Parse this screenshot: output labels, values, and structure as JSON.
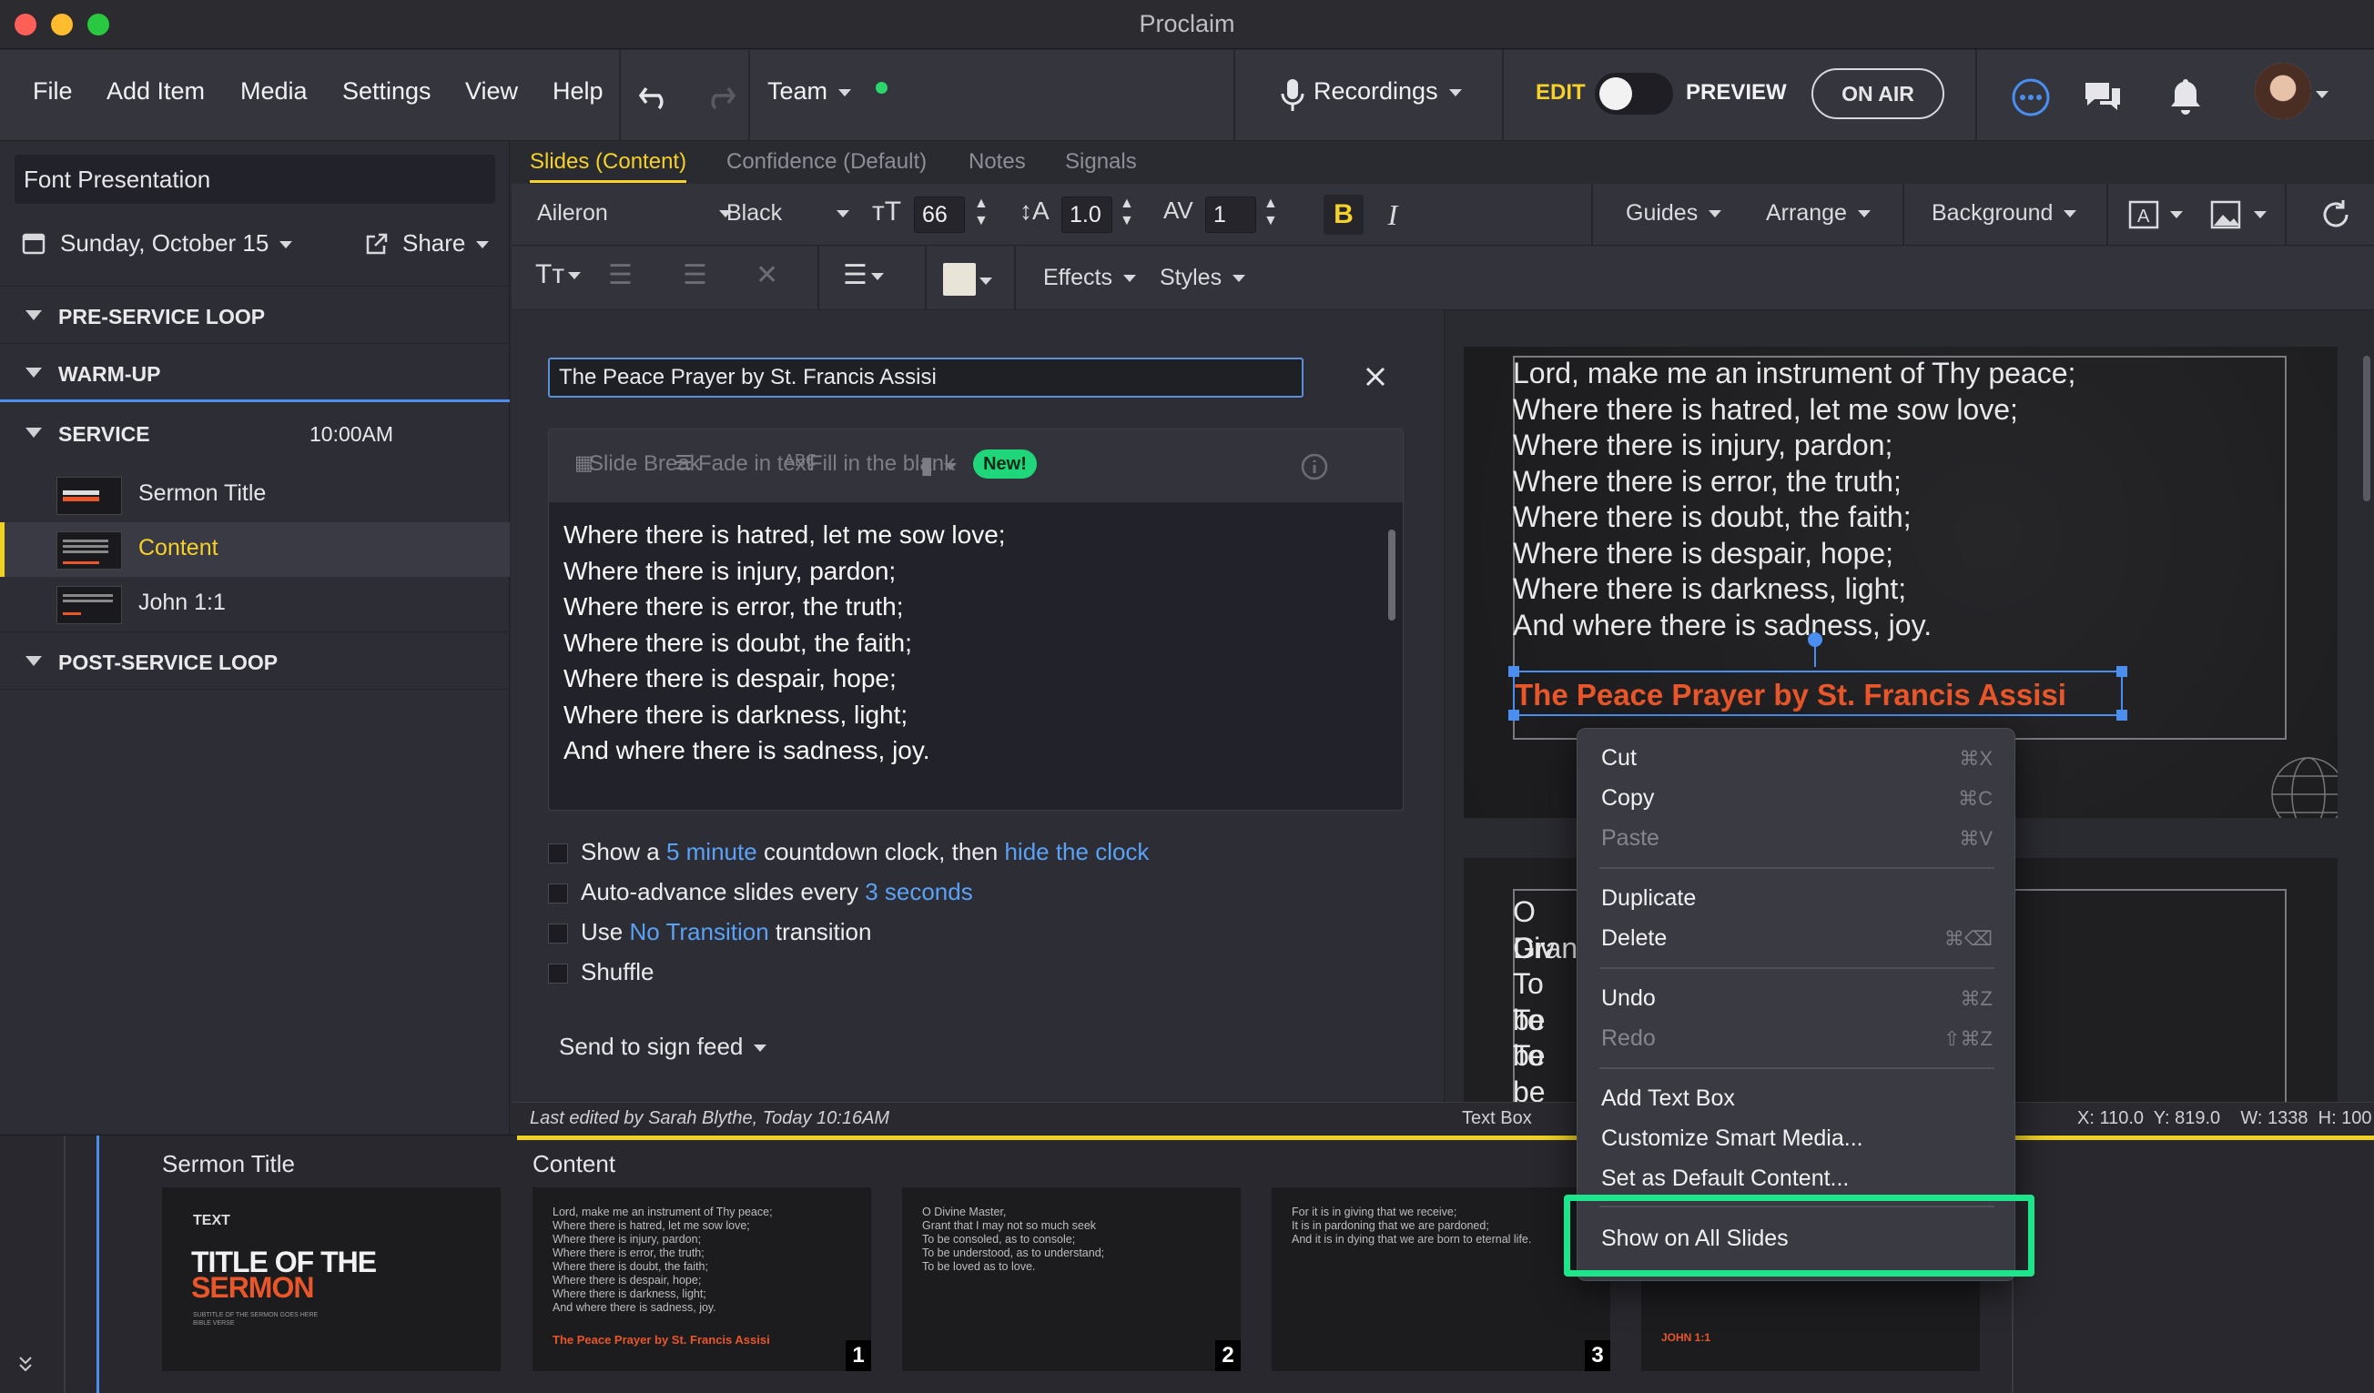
{
  "window": {
    "title": "Proclaim"
  },
  "menu": {
    "file": "File",
    "add_item": "Add Item",
    "media": "Media",
    "settings": "Settings",
    "view": "View",
    "help": "Help",
    "team": "Team",
    "recordings": "Recordings",
    "edit": "EDIT",
    "preview": "PREVIEW",
    "on_air": "ON AIR"
  },
  "sidebar": {
    "presentation_name": "Font Presentation",
    "date": "Sunday, October 15",
    "share": "Share",
    "sections": [
      {
        "label": "PRE-SERVICE LOOP"
      },
      {
        "label": "WARM-UP"
      },
      {
        "label": "SERVICE",
        "time": "10:00AM"
      },
      {
        "label": "POST-SERVICE LOOP"
      }
    ],
    "items": [
      {
        "label": "Sermon Title"
      },
      {
        "label": "Content"
      },
      {
        "label": "John 1:1"
      }
    ]
  },
  "tabs": [
    "Slides (Content)",
    "Confidence (Default)",
    "Notes",
    "Signals"
  ],
  "toolbar": {
    "font": "Aileron",
    "weight": "Black",
    "size": "66",
    "line_height": "1.0",
    "spacing": "1",
    "bold": "B",
    "italic": "I",
    "guides": "Guides",
    "arrange": "Arrange",
    "background": "Background",
    "effects": "Effects",
    "styles": "Styles",
    "fill_color": "#e8e4d8"
  },
  "content": {
    "title_value": "The Peace Prayer by St. Francis Assisi",
    "tools": {
      "slide_break": "Slide Break",
      "fade_in": "Fade in text",
      "fill_blank": "Fill in the blank",
      "new_badge": "New!"
    },
    "lines": [
      "Where there is hatred, let me sow love;",
      "Where there is injury, pardon;",
      "Where there is error, the truth;",
      "Where there is doubt, the faith;",
      "Where there is despair, hope;",
      "Where there is darkness, light;",
      "And where there is sadness, joy."
    ],
    "options": {
      "countdown_pre": "Show a",
      "countdown_link": "5 minute",
      "countdown_mid": "countdown clock, then",
      "countdown_link2": "hide the clock",
      "autoadv_pre": "Auto-advance slides every",
      "autoadv_link": "3 seconds",
      "trans_pre": "Use",
      "trans_link": "No Transition",
      "trans_post": "transition",
      "shuffle": "Shuffle"
    },
    "sign_feed": "Send to sign feed",
    "last_edited": "Last edited by Sarah Blythe, Today 10:16AM"
  },
  "preview": {
    "slide1_lines": [
      "Lord, make me an instrument of Thy peace;",
      "Where there is hatred, let me sow love;",
      "Where there is injury, pardon;",
      "Where there is error, the truth;",
      "Where there is doubt, the faith;",
      "Where there is despair, hope;",
      "Where there is darkness, light;",
      "And where there is sadness, joy."
    ],
    "slide1_title": "The Peace Prayer by St. Francis Assisi",
    "slide2_lines": [
      "O Div",
      "Gran",
      "To be",
      "To be",
      "To be"
    ],
    "accent": "#e8562a"
  },
  "status": {
    "selection": "Text Box",
    "coords": "X: 110.0  Y: 819.0    W: 1338  H: 100"
  },
  "context_menu": {
    "items": [
      {
        "label": "Cut",
        "shortcut": "⌘X",
        "enabled": true
      },
      {
        "label": "Copy",
        "shortcut": "⌘C",
        "enabled": true
      },
      {
        "label": "Paste",
        "shortcut": "⌘V",
        "enabled": false
      },
      {
        "label": "Duplicate",
        "shortcut": "",
        "enabled": true
      },
      {
        "label": "Delete",
        "shortcut": "⌘⌫",
        "enabled": true
      },
      {
        "label": "Undo",
        "shortcut": "⌘Z",
        "enabled": true
      },
      {
        "label": "Redo",
        "shortcut": "⇧⌘Z",
        "enabled": false
      },
      {
        "label": "Add Text Box",
        "shortcut": "",
        "enabled": true
      },
      {
        "label": "Customize Smart Media...",
        "shortcut": "",
        "enabled": true
      },
      {
        "label": "Set as Default Content...",
        "shortcut": "",
        "enabled": true
      },
      {
        "label": "Show on All Slides",
        "shortcut": "",
        "enabled": true
      }
    ]
  },
  "filmstrip": {
    "group1": "Sermon Title",
    "group2": "Content",
    "sermon_thumb": {
      "tag": "TEXT",
      "title1": "TITLE OF THE",
      "title2": "SERMON",
      "sub": "SUBTITLE OF THE SERMON GOES HERE\nBIBLE VERSE"
    },
    "thumbs": [
      {
        "num": "1",
        "text": "Lord, make me an instrument of Thy peace;\nWhere there is hatred, let me sow love;\nWhere there is injury, pardon;\nWhere there is error, the truth;\nWhere there is doubt, the faith;\nWhere there is despair, hope;\nWhere there is darkness, light;\nAnd where there is sadness, joy.",
        "title": "The Peace Prayer by St. Francis Assisi"
      },
      {
        "num": "2",
        "text": "O Divine Master,\nGrant that I may not so much seek\nTo be consoled, as to console;\nTo be understood, as to understand;\nTo be loved as to love."
      },
      {
        "num": "3",
        "text": "For it is in giving that we receive;\nIt is in pardoning that we are pardoned;\nAnd it is in dying that we are born to eternal life."
      },
      {
        "num": "",
        "text": "",
        "title": "JOHN 1:1"
      }
    ]
  }
}
